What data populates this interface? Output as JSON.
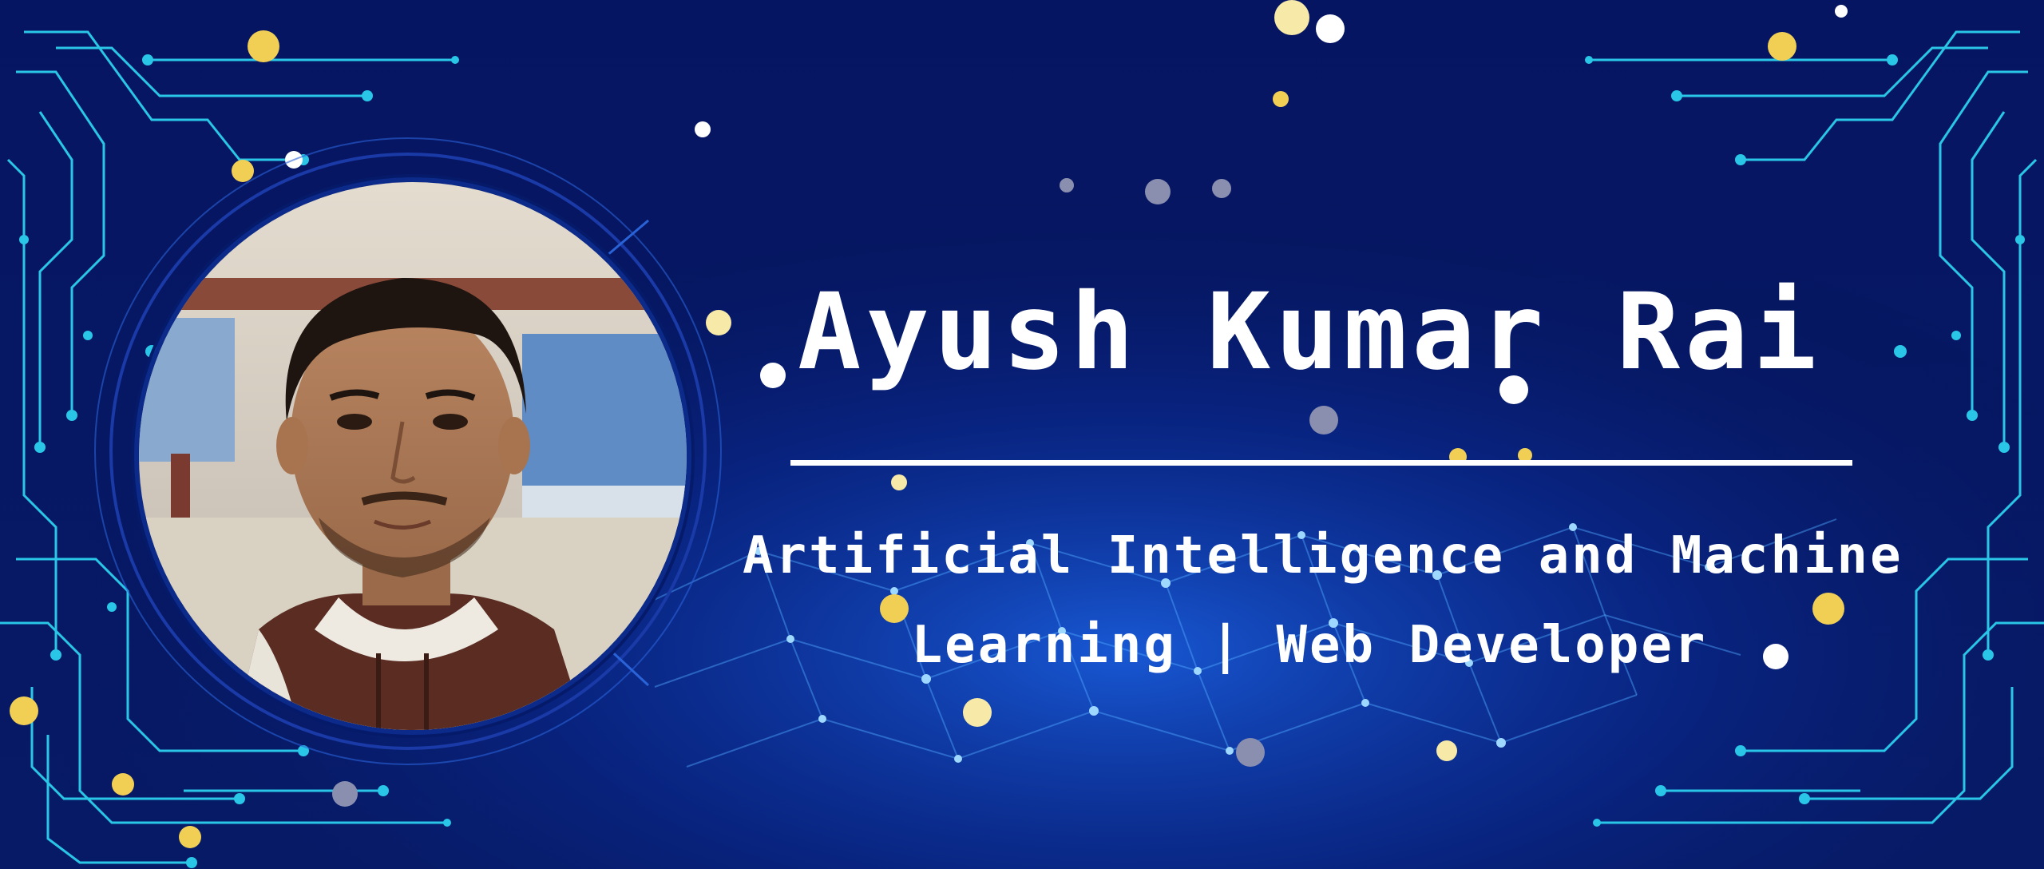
{
  "profile": {
    "name": "Ayush Kumar Rai",
    "tagline_line1": "Artificial Intelligence and Machine",
    "tagline_line2": "Learning | Web Developer"
  },
  "colors": {
    "background": "#04124f",
    "circuit": "#29c6e8",
    "bokeh_gold": "#f1cf55",
    "text": "#ffffff"
  }
}
